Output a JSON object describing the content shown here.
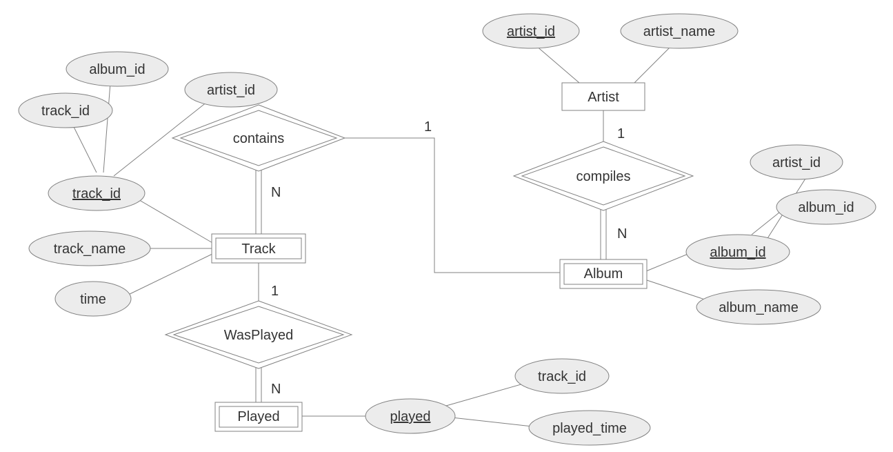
{
  "entities": {
    "artist": "Artist",
    "track": "Track",
    "album": "Album",
    "played": "Played"
  },
  "relationships": {
    "contains": "contains",
    "compiles": "compiles",
    "wasplayed": "WasPlayed"
  },
  "attributes": {
    "artist_id_key": "artist_id",
    "artist_name": "artist_name",
    "album_id": "album_id",
    "artist_id": "artist_id",
    "track_id": "track_id",
    "track_id_key": "track_id",
    "track_name": "track_name",
    "time": "time",
    "album_id_key": "album_id",
    "album_id_sub": "album_id",
    "artist_id_sub": "artist_id",
    "album_name": "album_name",
    "played_key": "played",
    "track_id_played": "track_id",
    "played_time": "played_time"
  },
  "card": {
    "one": "1",
    "n": "N"
  }
}
